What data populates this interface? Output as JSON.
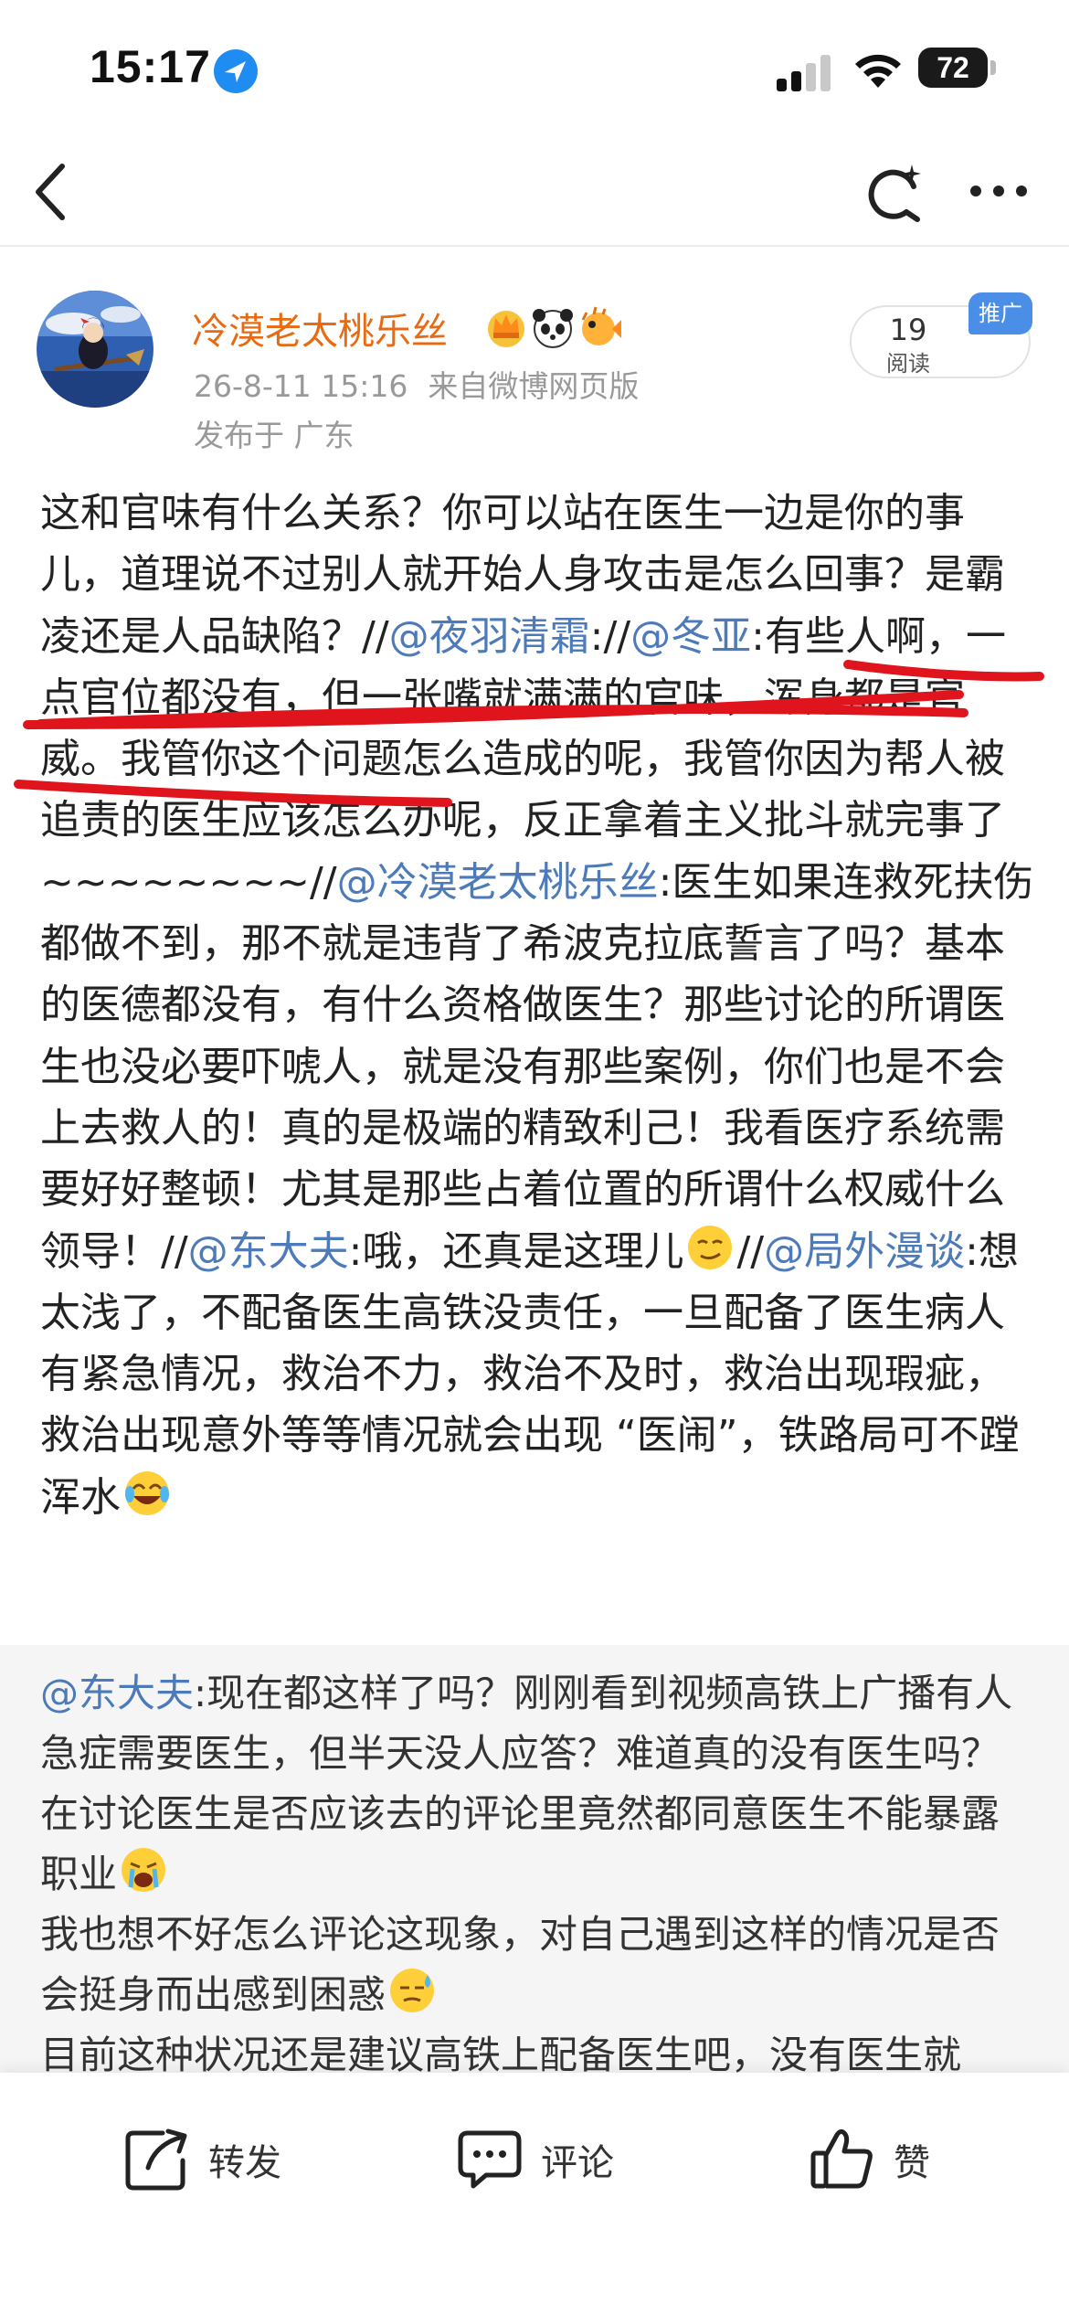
{
  "status_bar": {
    "time": "15:17",
    "battery": "72",
    "battery_level_percent": 72
  },
  "nav": {
    "icons": [
      "back-icon",
      "refresh-icon",
      "more-icon"
    ]
  },
  "post": {
    "author": "冷漠老太桃乐丝",
    "timestamp": "26-8-11 15:16",
    "source": "来自微博网页版",
    "location": "发布于 广东",
    "read_count": "19",
    "read_label": "阅读",
    "promo_badge": "推广",
    "text": {
      "s1": "这和官味有什么关系？你可以站在医生一边是你的事儿，道理说不过别人就开始人身攻击是怎么回事？是霸凌还是人品缺陷？//",
      "m1": "@夜羽清霜",
      "s2": ":",
      "sep2": "//",
      "m2": "@冬亚",
      "s3": ":有些人啊，一点官位都没有，但一张嘴就满满的官味，浑身都是官威。我管你这个问题怎么造成的呢，我管你因为帮人被追责的医生应该怎么办呢，反正拿着主义批斗就完事了 ~~~~~~~~//",
      "m3": "@冷漠老太桃乐丝",
      "s4": ":医生如果连救死扶伤都做不到，那不就是违背了希波克拉底誓言了吗？基本的医德都没有，有什么资格做医生？那些讨论的所谓医生也没必要吓唬人，就是没有那些案例，你们也是不会上去救人的！真的是极端的精致利己！我看医疗系统需要好好整顿！尤其是那些占着位置的所谓什么权威什么领导！//",
      "m4": "@东大夫",
      "s5": ":哦，还真是这理儿",
      "sep5": "//",
      "m5": "@局外漫谈",
      "s6": ":想太浅了，不配备医生高铁没责任，一旦配备了医生病人有紧急情况，救治不力，救治不及时，救治出现瑕疵，救治出现意外等等情况就会出现 “医闹”，铁路局可不蹚浑水"
    }
  },
  "repost": {
    "mention": "@东大夫",
    "p1": ":现在都这样了吗？刚刚看到视频高铁上广播有人急症需要医生，但半天没人应答？难道真的没有医生吗？在讨论医生是否应该去的评论里竟然都同意医生不能暴露职业",
    "p2": "我也想不好怎么评论这现象，对自己遇到这样的情况是否会挺身而出感到困惑",
    "p3": "目前这种状况还是建议高铁上配备医生吧，没有医生就"
  },
  "toolbar": {
    "repost_label": "转发",
    "comment_label": "评论",
    "like_label": "赞"
  },
  "colors": {
    "author": "#e86a12",
    "mention": "#4d7ab8",
    "meta": "#999999",
    "promo_badge": "#4a8ee8",
    "annotation_red": "#e0141c",
    "repost_bg": "#f5f5f6"
  }
}
